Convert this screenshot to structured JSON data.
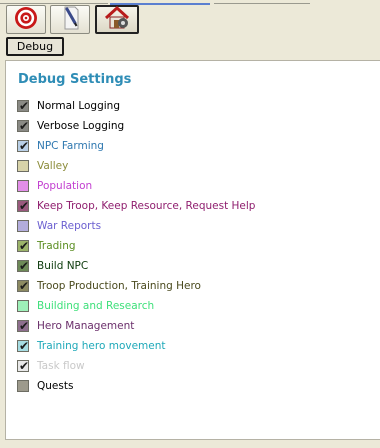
{
  "toolbar": {
    "buttons": [
      {
        "name": "target-icon",
        "active": false
      },
      {
        "name": "pencil-icon",
        "active": false
      },
      {
        "name": "house-icon",
        "active": true
      }
    ]
  },
  "subtab": {
    "label": "Debug"
  },
  "panel": {
    "title": "Debug Settings",
    "items": [
      {
        "label": "Normal Logging",
        "checked": true,
        "color": "#000000",
        "box": "#8a8a85"
      },
      {
        "label": "Verbose Logging",
        "checked": true,
        "color": "#000000",
        "box": "#8a8a85"
      },
      {
        "label": "NPC Farming",
        "checked": true,
        "color": "#2f78b0",
        "box": "#b9cfe6"
      },
      {
        "label": "Valley",
        "checked": false,
        "color": "#8c8c3a",
        "box": "#d8d3a9"
      },
      {
        "label": "Population",
        "checked": false,
        "color": "#c23ed0",
        "box": "#e28ee8"
      },
      {
        "label": "Keep Troop, Keep Resource, Request Help",
        "checked": true,
        "color": "#8f1e6e",
        "box": "#9a5a7e"
      },
      {
        "label": "War Reports",
        "checked": false,
        "color": "#6b5fd0",
        "box": "#b3addc"
      },
      {
        "label": "Trading",
        "checked": true,
        "color": "#5b8e22",
        "box": "#9cb46a"
      },
      {
        "label": "Build NPC",
        "checked": true,
        "color": "#0c3b0c",
        "box": "#6e8a58"
      },
      {
        "label": "Troop Production, Training Hero",
        "checked": true,
        "color": "#4a4a1e",
        "box": "#8c8a62"
      },
      {
        "label": "Building and Research",
        "checked": false,
        "color": "#3ee07a",
        "box": "#9ef0b8"
      },
      {
        "label": "Hero Management",
        "checked": true,
        "color": "#6b2f6b",
        "box": "#8e6f8e"
      },
      {
        "label": "Training hero movement",
        "checked": true,
        "color": "#1fa9b9",
        "box": "#a6dce2"
      },
      {
        "label": "Task flow",
        "checked": true,
        "color": "#c9c9c9",
        "box": "#e8e8e8"
      },
      {
        "label": "Quests",
        "checked": false,
        "color": "#000000",
        "box": "#9d9a8c"
      }
    ]
  }
}
